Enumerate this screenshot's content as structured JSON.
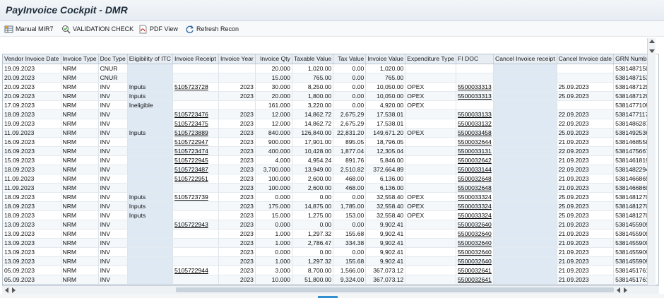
{
  "window": {
    "title": "PayInvoice Cockpit - DMR"
  },
  "toolbar": {
    "buttons": [
      {
        "label": "Manual MIR7",
        "icon": "table-icon"
      },
      {
        "label": "VALIDATION CHECK",
        "icon": "validation-icon"
      },
      {
        "label": "PDF View",
        "icon": "pdf-icon"
      },
      {
        "label": "Refresh Recon",
        "icon": "refresh-icon"
      }
    ]
  },
  "grid": {
    "columns": [
      "Vendor Invoice Date",
      "Invoice Type",
      "Doc Type",
      "Eligibility of ITC",
      "Invoice Receipt",
      "Invoice Year",
      "Invoice Qty",
      "Taxable Value",
      "Tax Value",
      "Invoice Value",
      "Expenditure Type",
      "FI DOC",
      "Cancel Invoice receipt",
      "Cancel Invoice date",
      "GRN Number"
    ],
    "rows": [
      [
        "19.09.2023",
        "NRM",
        "CNUR",
        "",
        "",
        "",
        "20.000",
        "1,020.00",
        "0.00",
        "1,020.00",
        "",
        "",
        "",
        "",
        "5381487150"
      ],
      [
        "20.09.2023",
        "NRM",
        "CNUR",
        "",
        "",
        "",
        "15.000",
        "765.00",
        "0.00",
        "765.00",
        "",
        "",
        "",
        "",
        "5381487153"
      ],
      [
        "20.09.2023",
        "NRM",
        "INV",
        "Inputs",
        "5105723728",
        "2023",
        "30.000",
        "8,250.00",
        "0.00",
        "10,050.00",
        "OPEX",
        "5500033313",
        "",
        "25.09.2023",
        "5381487129"
      ],
      [
        "20.09.2023",
        "NRM",
        "INV",
        "Inputs",
        "",
        "2023",
        "20.000",
        "1,800.00",
        "0.00",
        "10,050.00",
        "OPEX",
        "5500033313",
        "",
        "25.09.2023",
        "5381487129"
      ],
      [
        "17.09.2023",
        "NRM",
        "INV",
        "Ineligible",
        "",
        "",
        "161.000",
        "3,220.00",
        "0.00",
        "4,920.00",
        "OPEX",
        "",
        "",
        "",
        "5381477109"
      ],
      [
        "18.09.2023",
        "NRM",
        "INV",
        "",
        "5105723476",
        "2023",
        "12.000",
        "14,862.72",
        "2,675.29",
        "17,538.01",
        "",
        "5500033133",
        "",
        "22.09.2023",
        "5381477117"
      ],
      [
        "19.09.2023",
        "NRM",
        "INV",
        "",
        "5105723475",
        "2023",
        "12.000",
        "14,862.72",
        "2,675.29",
        "17,538.01",
        "",
        "5500033132",
        "",
        "22.09.2023",
        "5381486287"
      ],
      [
        "11.09.2023",
        "NRM",
        "INV",
        "Inputs",
        "5105723889",
        "2023",
        "840.000",
        "126,840.00",
        "22,831.20",
        "149,671.20",
        "OPEX",
        "5500033458",
        "",
        "25.09.2023",
        "5381492536"
      ],
      [
        "16.09.2023",
        "NRM",
        "INV",
        "",
        "5105722947",
        "2023",
        "900.000",
        "17,901.00",
        "895.05",
        "18,796.05",
        "",
        "5500032644",
        "",
        "21.09.2023",
        "5381468558"
      ],
      [
        "16.09.2023",
        "NRM",
        "INV",
        "",
        "5105723474",
        "2023",
        "400.000",
        "10,428.00",
        "1,877.04",
        "12,305.04",
        "",
        "5500033131",
        "",
        "22.09.2023",
        "5381475667"
      ],
      [
        "15.09.2023",
        "NRM",
        "INV",
        "",
        "5105722945",
        "2023",
        "4.000",
        "4,954.24",
        "891.76",
        "5,846.00",
        "",
        "5500032642",
        "",
        "21.09.2023",
        "5381461819"
      ],
      [
        "18.09.2023",
        "NRM",
        "INV",
        "",
        "5105723487",
        "2023",
        "3,700.000",
        "13,949.00",
        "2,510.82",
        "372,664.89",
        "",
        "5500033144",
        "",
        "22.09.2023",
        "5381482294"
      ],
      [
        "11.09.2023",
        "NRM",
        "INV",
        "",
        "5105722951",
        "2023",
        "100.000",
        "2,600.00",
        "468.00",
        "6,136.00",
        "",
        "5500032648",
        "",
        "21.09.2023",
        "5381466869"
      ],
      [
        "11.09.2023",
        "NRM",
        "INV",
        "",
        "",
        "2023",
        "100.000",
        "2,600.00",
        "468.00",
        "6,136.00",
        "",
        "5500032648",
        "",
        "21.09.2023",
        "5381466869"
      ],
      [
        "18.09.2023",
        "NRM",
        "INV",
        "Inputs",
        "5105723739",
        "2023",
        "0.000",
        "0.00",
        "0.00",
        "32,558.40",
        "OPEX",
        "5500033324",
        "",
        "25.09.2023",
        "5381481270"
      ],
      [
        "18.09.2023",
        "NRM",
        "INV",
        "Inputs",
        "",
        "2023",
        "175.000",
        "14,875.00",
        "1,785.00",
        "32,558.40",
        "OPEX",
        "5500033324",
        "",
        "25.09.2023",
        "5381481270"
      ],
      [
        "18.09.2023",
        "NRM",
        "INV",
        "Inputs",
        "",
        "2023",
        "15.000",
        "1,275.00",
        "153.00",
        "32,558.40",
        "OPEX",
        "5500033324",
        "",
        "25.09.2023",
        "5381481270"
      ],
      [
        "13.09.2023",
        "NRM",
        "INV",
        "",
        "5105722943",
        "2023",
        "0.000",
        "0.00",
        "0.00",
        "9,902.41",
        "",
        "5500032640",
        "",
        "21.09.2023",
        "5381455909"
      ],
      [
        "13.09.2023",
        "NRM",
        "INV",
        "",
        "",
        "2023",
        "1.000",
        "1,297.32",
        "155.68",
        "9,902.41",
        "",
        "5500032640",
        "",
        "21.09.2023",
        "5381455909"
      ],
      [
        "13.09.2023",
        "NRM",
        "INV",
        "",
        "",
        "2023",
        "1.000",
        "2,786.47",
        "334.38",
        "9,902.41",
        "",
        "5500032640",
        "",
        "21.09.2023",
        "5381455909"
      ],
      [
        "13.09.2023",
        "NRM",
        "INV",
        "",
        "",
        "2023",
        "0.000",
        "0.00",
        "0.00",
        "9,902.41",
        "",
        "5500032640",
        "",
        "21.09.2023",
        "5381455909"
      ],
      [
        "13.09.2023",
        "NRM",
        "INV",
        "",
        "",
        "2023",
        "1.000",
        "1,297.32",
        "155.68",
        "9,902.41",
        "",
        "5500032640",
        "",
        "21.09.2023",
        "5381455909"
      ],
      [
        "05.09.2023",
        "NRM",
        "INV",
        "",
        "5105722944",
        "2023",
        "3.000",
        "8,700.00",
        "1,566.00",
        "367,073.12",
        "",
        "5500032641",
        "",
        "21.09.2023",
        "5381451761"
      ],
      [
        "05.09.2023",
        "NRM",
        "INV",
        "",
        "",
        "2023",
        "10.000",
        "51,800.00",
        "9,324.00",
        "367,073.12",
        "",
        "5500032641",
        "",
        "21.09.2023",
        "5381451761"
      ]
    ]
  }
}
